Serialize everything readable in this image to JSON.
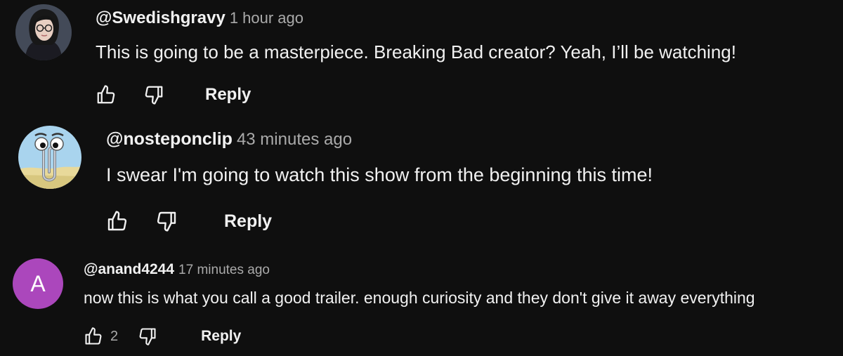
{
  "comments": [
    {
      "author": "@Swedishgravy",
      "time": "1 hour ago",
      "text": "This is going to be a masterpiece. Breaking Bad creator? Yeah, I’ll be watching!",
      "avatar_icon": "portrait-avatar",
      "like_icon": "thumbs-up-icon",
      "dislike_icon": "thumbs-down-icon",
      "reply_label": "Reply"
    },
    {
      "author": "@nosteponclip",
      "time": "43 minutes ago",
      "text": "I swear I'm going to watch this show from the beginning this time!",
      "avatar_icon": "paperclip-avatar",
      "like_icon": "thumbs-up-icon",
      "dislike_icon": "thumbs-down-icon",
      "reply_label": "Reply"
    },
    {
      "author": "@anand4244",
      "time": "17 minutes ago",
      "text": "now this is what you call a good trailer. enough curiosity and they don't give it away everything",
      "avatar_letter": "A",
      "avatar_color": "#ab47bc",
      "like_count": "2",
      "like_icon": "thumbs-up-icon",
      "dislike_icon": "thumbs-down-icon",
      "reply_label": "Reply"
    }
  ],
  "colors": {
    "background": "#0f0f0f",
    "primary_text": "#f1f1f1",
    "secondary_text": "#aaaaaa"
  }
}
